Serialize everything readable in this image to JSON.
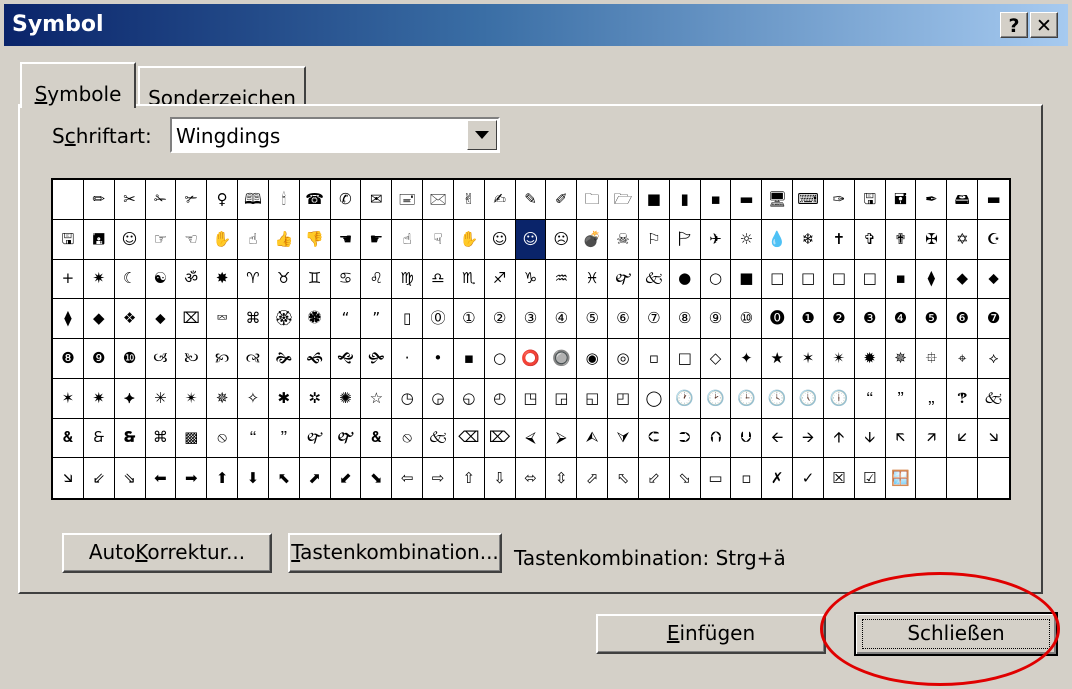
{
  "window": {
    "title": "Symbol",
    "help_label": "?",
    "close_label": "✕"
  },
  "tabs": [
    {
      "label": "Symbole",
      "underline": "S",
      "rest": "ymbole"
    },
    {
      "label": "Sonderzeichen",
      "before": "S",
      "underline": "o",
      "rest": "nderzeichen"
    }
  ],
  "font": {
    "label_before": "S",
    "label_underline": "c",
    "label_rest": "hriftart:",
    "value": "Wingdings"
  },
  "symbols": [
    [
      " ",
      "✏",
      "✂",
      "✁",
      "✃",
      "♀",
      "🕮",
      "🕯",
      "☎",
      "✆",
      "✉",
      "🖃",
      "🖂",
      "✌",
      "✍",
      "✎",
      "✐",
      "🗀",
      "🗁",
      "■",
      "▮",
      "▪",
      "▬",
      "🖥",
      "⌨",
      "✑",
      "🖫",
      "🖬",
      "✒",
      "🖴",
      "▬"
    ],
    [
      "🖫",
      "🖪",
      "☺",
      "☞",
      "☜",
      "✋",
      "☝",
      "👍",
      "👎",
      "☚",
      "☛",
      "☝",
      "☟",
      "✋",
      "☺",
      "☺",
      "☹",
      "💣",
      "☠",
      "⚐",
      "🏱",
      "✈",
      "☼",
      "💧",
      "❄",
      "✝",
      "✞",
      "✟",
      "✠",
      "✡",
      "☪"
    ],
    [
      "+",
      "✷",
      "☾",
      "☯",
      "ॐ",
      "✸",
      "♈",
      "♉",
      "♊",
      "♋",
      "♌",
      "♍",
      "♎",
      "♏",
      "♐",
      "♑",
      "♒",
      "♓",
      "🙰",
      "🙵",
      "●",
      "○",
      "■",
      "□",
      "□",
      "□",
      "□",
      "▪",
      "⧫",
      "◆",
      "⬥"
    ],
    [
      "⧫",
      "◆",
      "❖",
      "⬥",
      "⌧",
      "⮹",
      "⌘",
      "🏵",
      "🏶",
      "“",
      "”",
      "▯",
      "⓪",
      "①",
      "②",
      "③",
      "④",
      "⑤",
      "⑥",
      "⑦",
      "⑧",
      "⑨",
      "⑩",
      "⓿",
      "❶",
      "❷",
      "❸",
      "❹",
      "❺",
      "❻",
      "❼"
    ],
    [
      "❽",
      "❾",
      "❿",
      "🙢",
      "🙠",
      "🙡",
      "🙣",
      "🙞",
      "🙜",
      "🙝",
      "🙟",
      "·",
      "•",
      "▪",
      "○",
      "⭕",
      "🔘",
      "◉",
      "◎",
      "▫",
      "□",
      "◇",
      "✦",
      "★",
      "✶",
      "✴",
      "✹",
      "✵",
      "⯐",
      "⌖",
      "⟡"
    ],
    [
      "✶",
      "✷",
      "⯌",
      "✳",
      "✴",
      "✵",
      "✧",
      "✱",
      "✲",
      "✺",
      "☆",
      "◷",
      "◶",
      "◵",
      "◴",
      "◳",
      "◲",
      "◱",
      "◰",
      "◯",
      "🕐",
      "🕑",
      "🕒",
      "🕓",
      "🕔",
      "🕕",
      "🙶",
      "🙷",
      "🙸",
      "🙹",
      "🙵"
    ],
    [
      "🙴",
      "🙲",
      "🙳",
      "⌘",
      "▩",
      "⦸",
      "🙶",
      "🙷",
      "🙰",
      "🙱",
      "🙴",
      "⦸",
      "🙵",
      "⌫",
      "⌦",
      "⮘",
      "⮚",
      "⮙",
      "⮛",
      "⮈",
      "⮊",
      "⮉",
      "⮋",
      "🡨",
      "🡪",
      "🡩",
      "🡫",
      "🡬",
      "🡭",
      "🡯",
      "🡮"
    ],
    [
      "🡮",
      "⇙",
      "⇘",
      "⬅",
      "➡",
      "⬆",
      "⬇",
      "⬉",
      "⬈",
      "⬋",
      "⬊",
      "⇦",
      "⇨",
      "⇧",
      "⇩",
      "⬄",
      "⇳",
      "⬀",
      "⬁",
      "⬃",
      "⬂",
      "▭",
      "▫",
      "✗",
      "✓",
      "☒",
      "☑",
      "🪟",
      "",
      "",
      " "
    ]
  ],
  "selected": {
    "row": 1,
    "col": 15
  },
  "buttons": {
    "autokorrektur": {
      "label": "AutoKorrektur...",
      "before": "Auto",
      "underline": "K",
      "rest": "orrektur..."
    },
    "tastenkombination": {
      "label": "Tastenkombination...",
      "underline": "T",
      "rest": "astenkombination..."
    },
    "einfuegen": {
      "label": "Einfügen",
      "underline": "E",
      "rest": "infügen"
    },
    "schliessen": {
      "label": "Schließen"
    }
  },
  "shortcut_text": "Tastenkombination:  Strg+ä",
  "highlight_color": "#e00000"
}
